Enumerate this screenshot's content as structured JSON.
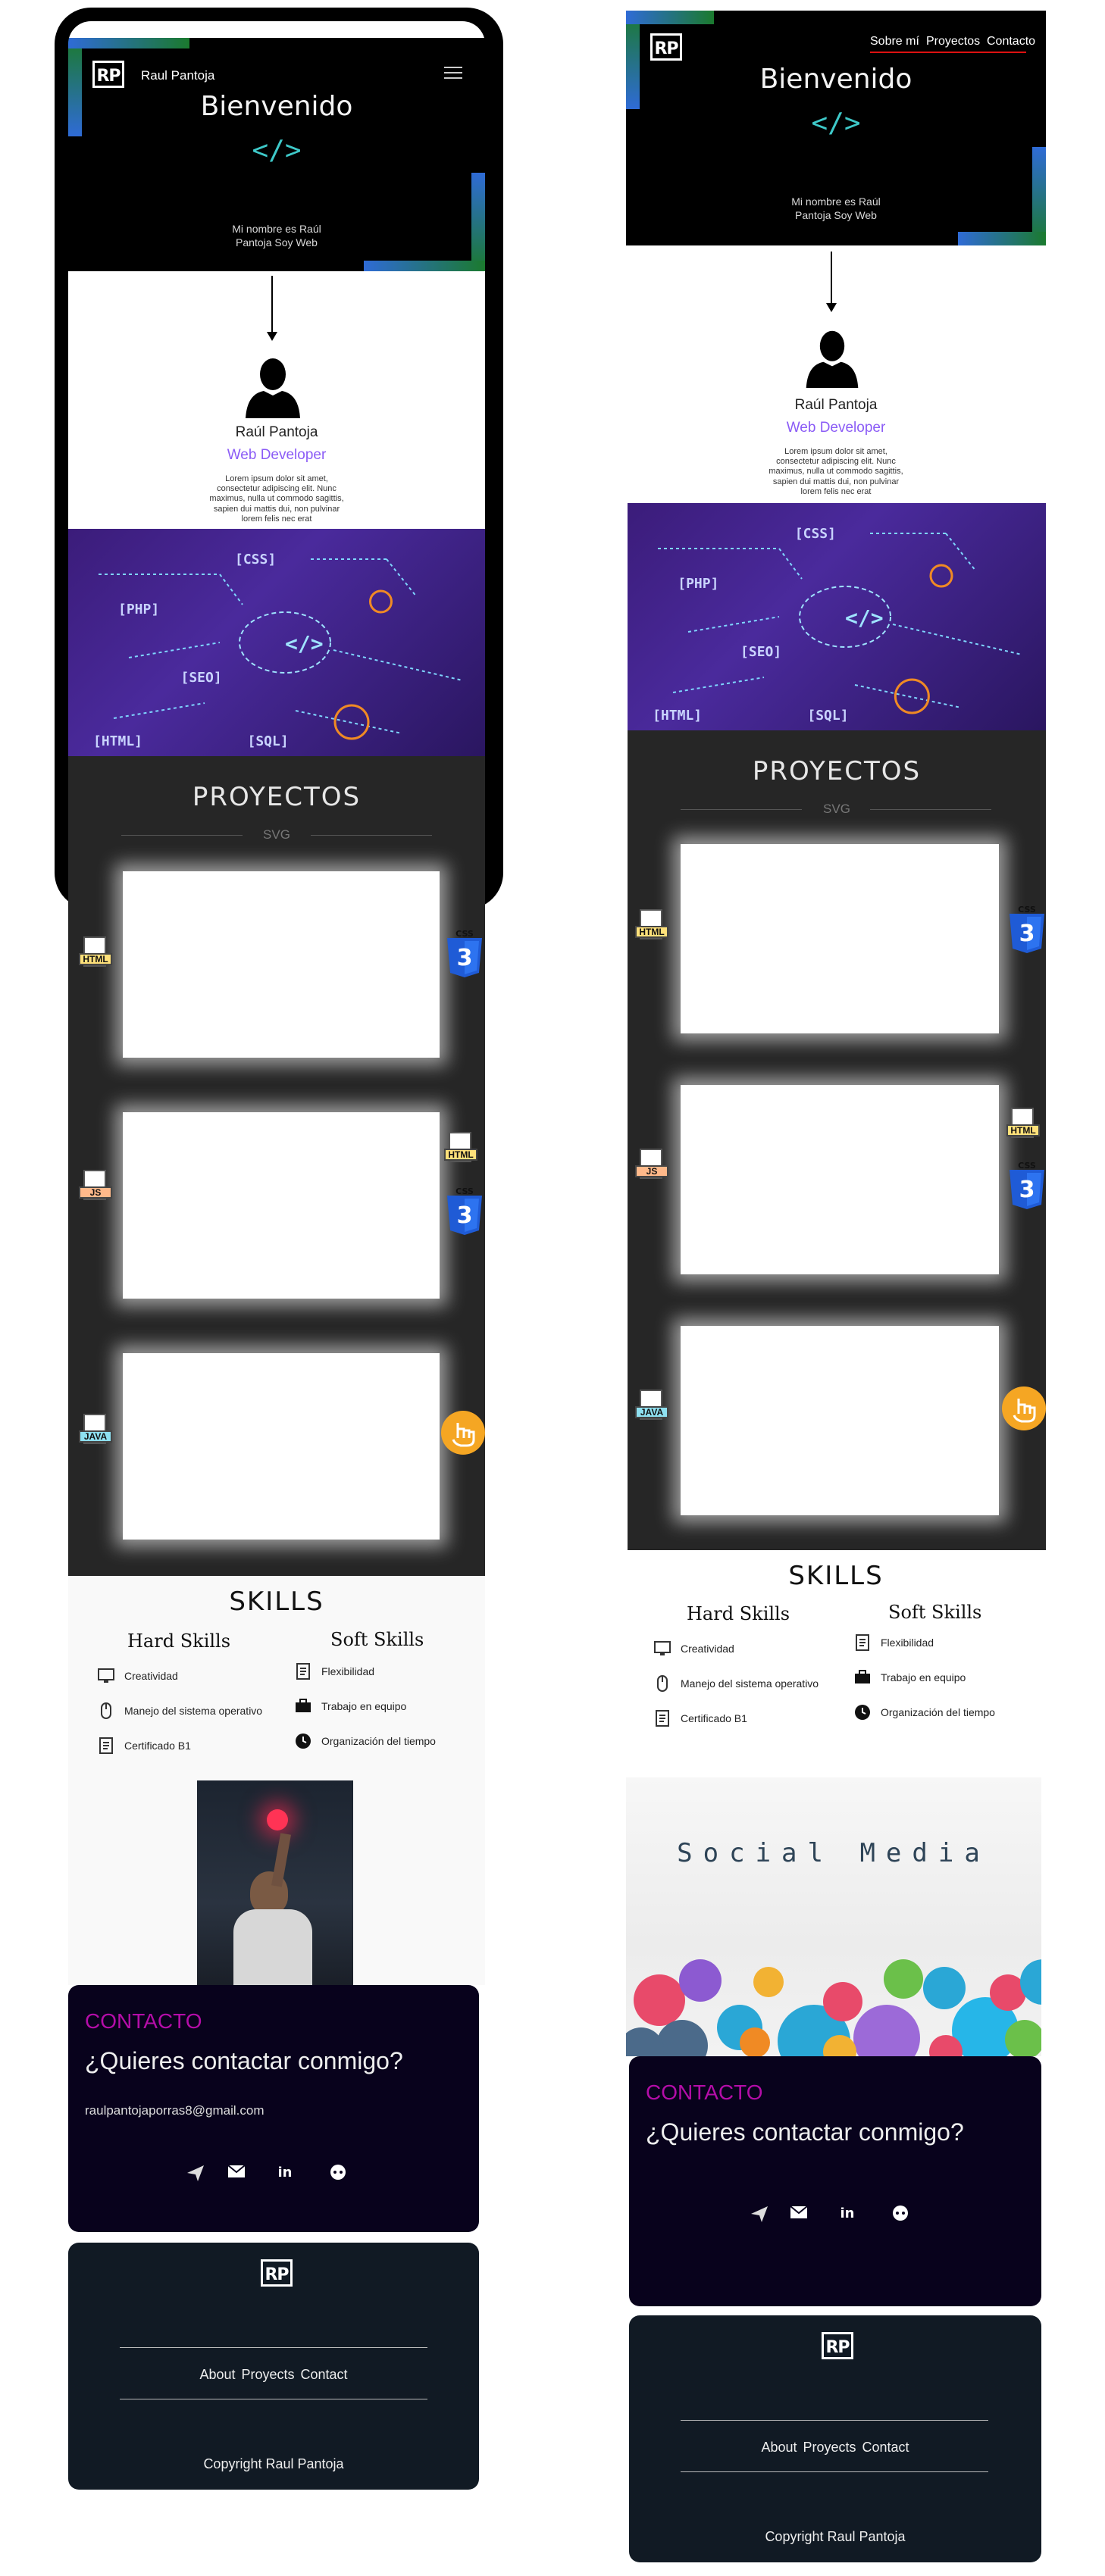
{
  "brand": {
    "logo_text": "RP",
    "name": "Raul Pantoja"
  },
  "nav": {
    "about": "Sobre mí",
    "projects": "Proyectos",
    "contact": "Contacto"
  },
  "hero": {
    "title": "Bienvenido",
    "code_symbol": "</>",
    "subtitle_line1": "Mi nombre es Raúl",
    "subtitle_line2": "Pantoja Soy Web"
  },
  "profile": {
    "name": "Raúl Pantoja",
    "role": "Web Developer",
    "desc_lines": [
      "Lorem ipsum dolor sit amet,",
      "consectetur adipiscing elit. Nunc",
      "maximus, nulla ut commodo sagittis,",
      "sapien dui mattis dui, non pulvinar",
      "lorem felis nec erat"
    ]
  },
  "tech_image": {
    "labels": [
      "CSS",
      "PHP",
      "SEO",
      "SQL",
      "HTML",
      "</>"
    ]
  },
  "projects": {
    "title": "PROYECTOS",
    "svg_label": "SVG",
    "badges": {
      "html": "HTML",
      "css": "CSS",
      "js": "JS",
      "java": "JAVA"
    }
  },
  "skills": {
    "title": "SKILLS",
    "hard_title": "Hard Skills",
    "soft_title": "Soft Skills",
    "hard": [
      "Creatividad",
      "Manejo del sistema operativo",
      "Certificado B1"
    ],
    "soft": [
      "Flexibilidad",
      "Trabajo en equipo",
      "Organización del tiempo"
    ]
  },
  "social_media": {
    "title": "Social Media"
  },
  "contact": {
    "label": "CONTACTO",
    "question": "¿Quieres contactar conmigo?",
    "email": "raulpantojaporras8@gmail.com"
  },
  "footer": {
    "links": [
      "About",
      "Proyects",
      "Contact"
    ],
    "copyright": "Copyright Raul Pantoja"
  },
  "colors": {
    "accent_purple": "#8b5cf6",
    "contact_bg": "#08021c",
    "footer_bg": "#111a24",
    "projects_bg": "#262626",
    "hero_bg": "#000000",
    "contact_label": "#b40da8"
  }
}
